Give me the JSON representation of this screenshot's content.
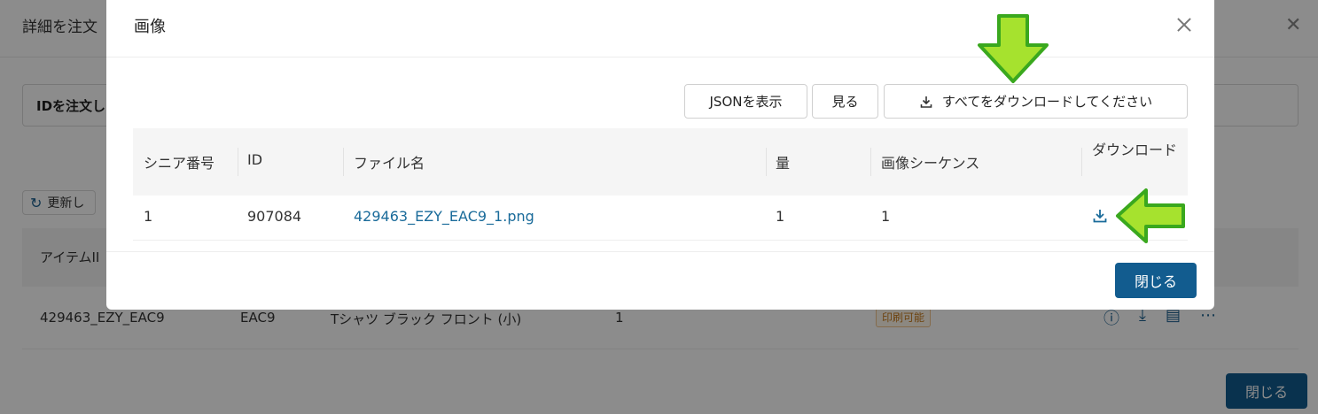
{
  "background": {
    "title": "詳細を注文",
    "order_label": "IDを注文し",
    "refresh_label": "更新し",
    "table_header_first": "アイテムII",
    "row": {
      "item_id": "429463_EZY_EAC9",
      "code": "EAC9",
      "name": "Tシャツ ブラック フロント (小)",
      "qty": "1",
      "status_badge": "印刷可能"
    },
    "close_label": "閉じる"
  },
  "modal": {
    "title": "画像",
    "toolbar": {
      "json_label": "JSONを表示",
      "view_label": "見る",
      "download_all_label": "すべてをダウンロードしてください"
    },
    "table": {
      "columns": [
        "シニア番号",
        "ID",
        "ファイル名",
        "量",
        "画像シーケンス",
        "ダウンロード"
      ],
      "rows": [
        {
          "serial": "1",
          "id": "907084",
          "file_name": "429463_EZY_EAC9_1.png",
          "qty": "1",
          "sequence": "1"
        }
      ]
    },
    "close_label": "閉じる"
  },
  "icons": {
    "modal_close": "close-icon",
    "download": "download-icon",
    "refresh": "refresh-icon"
  },
  "colors": {
    "primary": "#125c8f",
    "link": "#1a6b9a",
    "arrow_fill": "#a6e22e",
    "arrow_stroke": "#3aa81e"
  }
}
